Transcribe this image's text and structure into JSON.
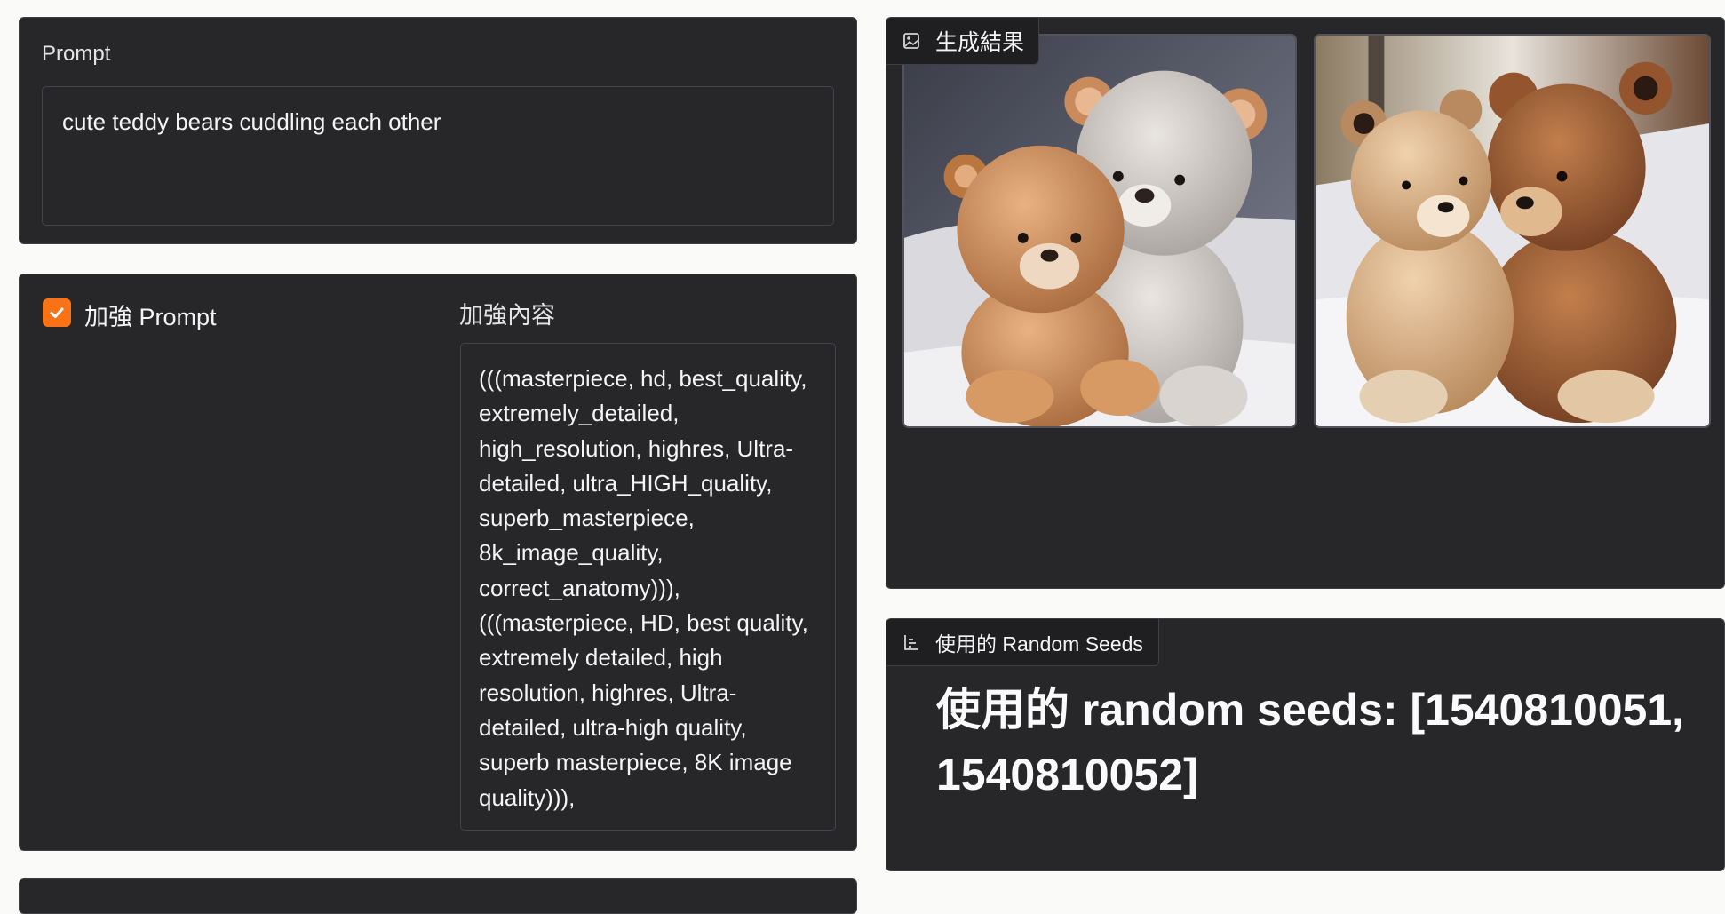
{
  "prompt": {
    "label": "Prompt",
    "value": "cute teddy bears cuddling each other"
  },
  "enhance": {
    "checkbox_label": "加強 Prompt",
    "checked": true,
    "content_label": "加強內容",
    "content_value": "(((masterpiece, hd, best_quality, extremely_detailed, high_resolution, highres, Ultra-detailed, ultra_HIGH_quality, superb_masterpiece, 8k_image_quality, correct_anatomy))), (((masterpiece, HD, best quality, extremely detailed, high resolution, highres, Ultra-detailed, ultra-high quality, superb masterpiece, 8K image quality))),"
  },
  "gallery": {
    "label": "生成結果",
    "icon": "image-icon",
    "images": [
      {
        "name": "generated-image-1",
        "subject": "teddy-bears"
      },
      {
        "name": "generated-image-2",
        "subject": "teddy-bears"
      }
    ]
  },
  "seeds": {
    "label": "使用的 Random Seeds",
    "icon": "bar-chart-icon",
    "text": "使用的 random seeds: [1540810051, 1540810052]"
  },
  "colors": {
    "accent": "#f97316",
    "panel_bg": "#27272a",
    "page_bg": "#fafaf9"
  }
}
